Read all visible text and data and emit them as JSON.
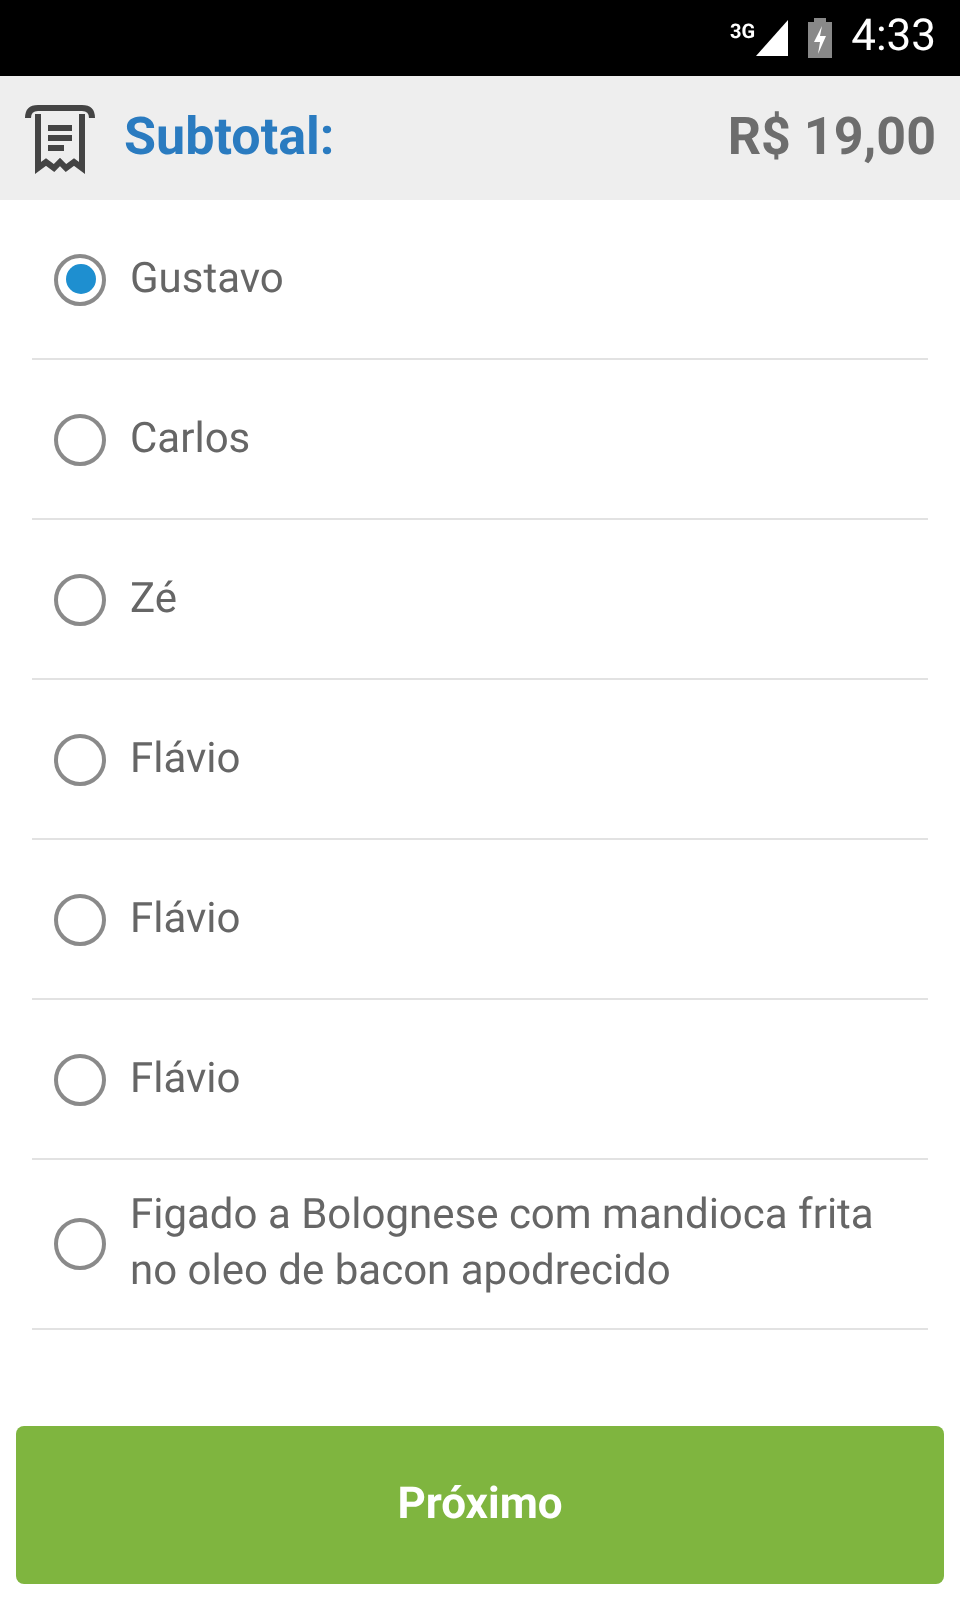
{
  "status_bar": {
    "network": "3G",
    "time": "4:33"
  },
  "header": {
    "label": "Subtotal:",
    "total": "R$ 19,00"
  },
  "options": [
    {
      "label": "Gustavo",
      "selected": true
    },
    {
      "label": "Carlos",
      "selected": false
    },
    {
      "label": "Zé",
      "selected": false
    },
    {
      "label": "Flávio",
      "selected": false
    },
    {
      "label": "Flávio",
      "selected": false
    },
    {
      "label": "Flávio",
      "selected": false
    },
    {
      "label": "Figado a Bolognese com mandioca frita no oleo de bacon apodrecido",
      "selected": false
    }
  ],
  "button": {
    "label": "Próximo"
  }
}
